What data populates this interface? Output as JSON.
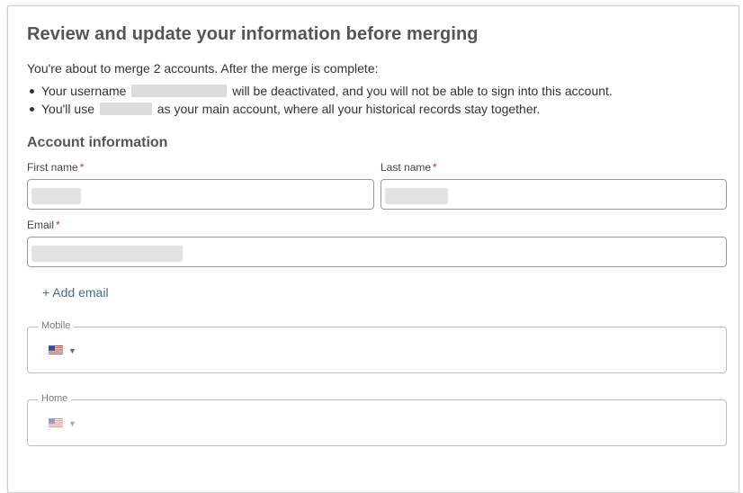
{
  "dialog": {
    "title": "Review and update your information before merging",
    "intro": "You're about to merge 2 accounts. After the merge is complete:",
    "bullet1_prefix": "Your username",
    "bullet1_suffix": "will be deactivated, and you will not be able to sign into this account.",
    "bullet2_prefix": "You'll use",
    "bullet2_suffix": "as your main account, where all your historical records stay together."
  },
  "account_section": {
    "title": "Account information",
    "first_name_label": "First name",
    "last_name_label": "Last name",
    "email_label": "Email",
    "required_mark": "*",
    "add_email_label": "+ Add email"
  },
  "phones": {
    "mobile_label": "Mobile",
    "home_label": "Home",
    "flag_icon": "us-flag-icon",
    "caret_icon": "caret-down-icon"
  },
  "colors": {
    "required": "#d0312d",
    "link": "#4b6a8c",
    "heading": "#555555"
  }
}
